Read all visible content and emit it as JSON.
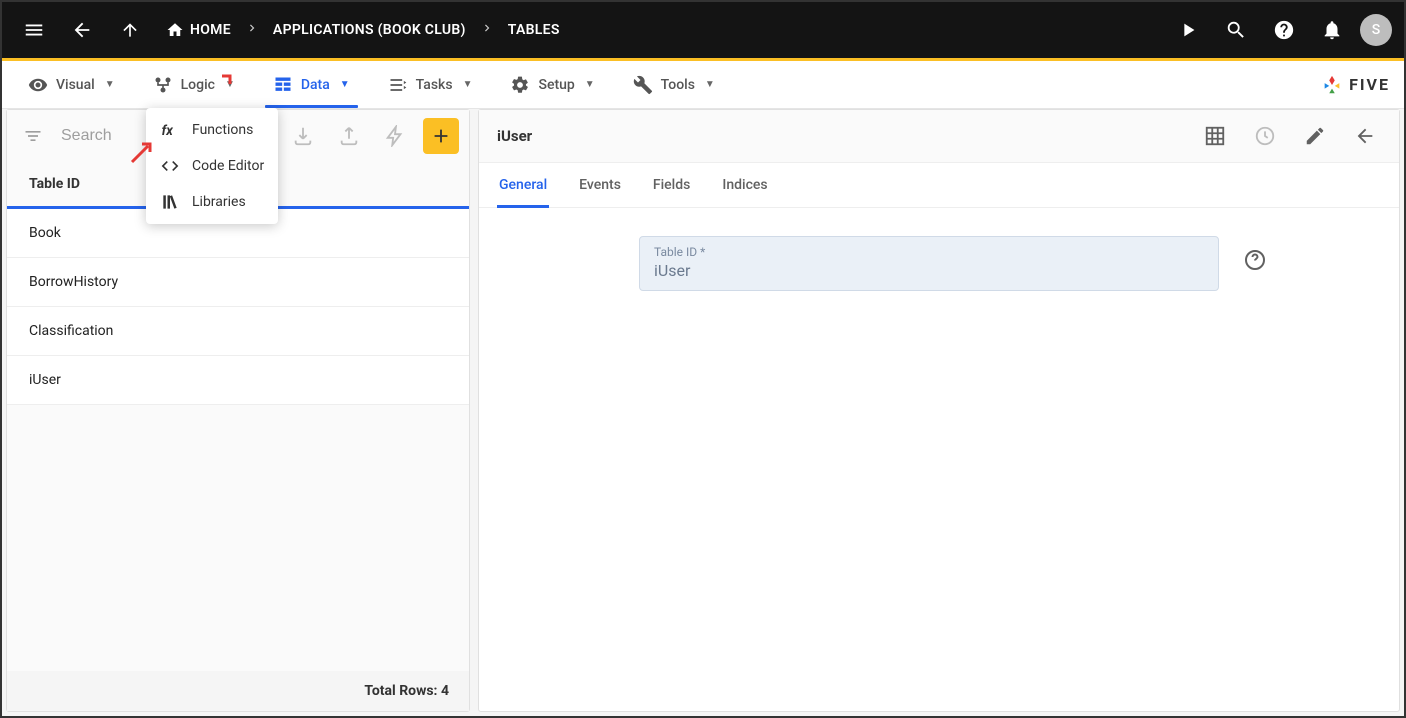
{
  "breadcrumb": {
    "home": "HOME",
    "apps": "APPLICATIONS (BOOK CLUB)",
    "tables": "TABLES"
  },
  "avatar": "S",
  "menu": {
    "visual": "Visual",
    "logic": "Logic",
    "data": "Data",
    "tasks": "Tasks",
    "setup": "Setup",
    "tools": "Tools"
  },
  "logic_dropdown": {
    "functions": "Functions",
    "code_editor": "Code Editor",
    "libraries": "Libraries"
  },
  "brand": "FIVE",
  "search_placeholder": "Search",
  "left": {
    "header": "Table ID",
    "rows": [
      "Book",
      "BorrowHistory",
      "Classification",
      "iUser"
    ],
    "footer": "Total Rows: 4"
  },
  "right": {
    "title": "iUser",
    "tabs": {
      "general": "General",
      "events": "Events",
      "fields": "Fields",
      "indices": "Indices"
    },
    "field_label": "Table ID *",
    "field_value": "iUser"
  }
}
